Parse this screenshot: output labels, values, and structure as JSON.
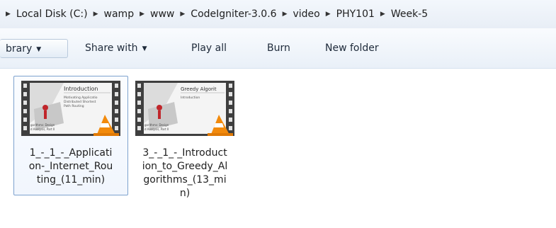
{
  "breadcrumb": {
    "items": [
      "Local Disk (C:)",
      "wamp",
      "www",
      "CodeIgniter-3.0.6",
      "video",
      "PHY101",
      "Week-5"
    ]
  },
  "toolbar": {
    "library_label": "brary",
    "share_label": "Share with",
    "play_all_label": "Play all",
    "burn_label": "Burn",
    "new_folder_label": "New folder"
  },
  "files": [
    {
      "name": "1_-_1_-_Applicati\non-_Internet_Rou\nting_(11_min)",
      "slide_title": "Introduction",
      "slide_lines": [
        "Motivating Applicatio",
        "Distributed Shortest",
        "Path Routing"
      ],
      "slide_footer": [
        "gorithms: Design",
        "d Analysis, Part II"
      ]
    },
    {
      "name": "3_-_1_-_Introduct\nion_to_Greedy_Al\ngorithms_(13_mi\nn)",
      "slide_title": "Greedy Algorit",
      "slide_lines": [
        "Introduction"
      ],
      "slide_footer": [
        "gorithms: Design",
        "d Analysis, Part II"
      ]
    }
  ],
  "colors": {
    "selection_border": "#7da2ce",
    "film_strip": "#3f3f3f",
    "vlc_cone": "#f28a0c"
  },
  "icons": {
    "separator": "chevron-right-icon",
    "dropdown": "dropdown-arrow-icon",
    "overlay": "vlc-cone-icon"
  }
}
